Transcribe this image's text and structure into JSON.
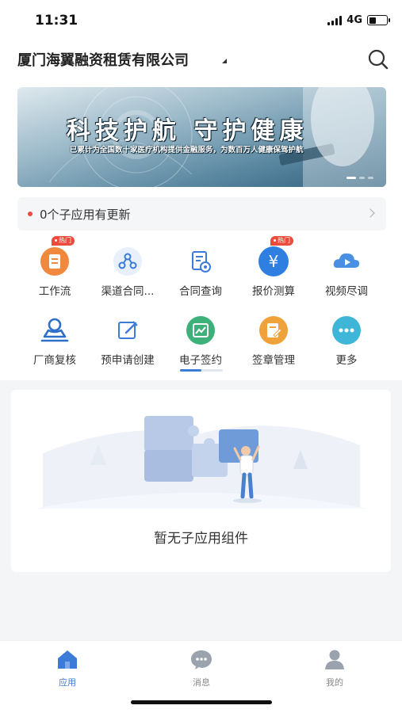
{
  "status": {
    "time": "11:31",
    "network": "4G",
    "battery_fraction": 0.4
  },
  "header": {
    "company": "厦门海翼融资租赁有限公司"
  },
  "banner": {
    "title": "科技护航 守护健康",
    "subtitle": "已累计为全国数十家医疗机构提供金融服务，为数百万人健康保驾护航"
  },
  "notice": {
    "text": "0个子应用有更新"
  },
  "hot_badge": "热门",
  "apps": [
    {
      "label": "工作流",
      "icon": "workflow-icon",
      "color": "#f0883e",
      "hot": true
    },
    {
      "label": "渠道合同...",
      "icon": "channel-contract-icon",
      "color": "#3c7bd8",
      "hot": false
    },
    {
      "label": "合同查询",
      "icon": "contract-query-icon",
      "color": "#3c7bd8",
      "hot": false
    },
    {
      "label": "报价测算",
      "icon": "quote-calc-icon",
      "color": "#2f7fe0",
      "hot": true
    },
    {
      "label": "视频尽调",
      "icon": "video-call-icon",
      "color": "#4a90e2",
      "hot": false
    },
    {
      "label": "厂商复核",
      "icon": "vendor-review-icon",
      "color": "#2f6fc9",
      "hot": false
    },
    {
      "label": "预申请创建",
      "icon": "pre-apply-icon",
      "color": "#3c7bd8",
      "hot": false
    },
    {
      "label": "电子签约",
      "icon": "e-sign-icon",
      "color": "#3eb07a",
      "hot": false
    },
    {
      "label": "签章管理",
      "icon": "seal-manage-icon",
      "color": "#f0a23a",
      "hot": false
    },
    {
      "label": "更多",
      "icon": "more-icon",
      "color": "#3fb6d8",
      "hot": false
    }
  ],
  "page_indicator": {
    "pages": 2,
    "current": 1
  },
  "widget_area": {
    "empty_text": "暂无子应用组件"
  },
  "tabbar": {
    "tabs": [
      {
        "label": "应用",
        "icon": "apps-icon",
        "active": true
      },
      {
        "label": "消息",
        "icon": "message-icon",
        "active": false
      },
      {
        "label": "我的",
        "icon": "profile-icon",
        "active": false
      }
    ]
  },
  "colors": {
    "accent": "#3c7bd8",
    "hot": "#ea4b3b",
    "notice_dot": "#e94d3d"
  }
}
